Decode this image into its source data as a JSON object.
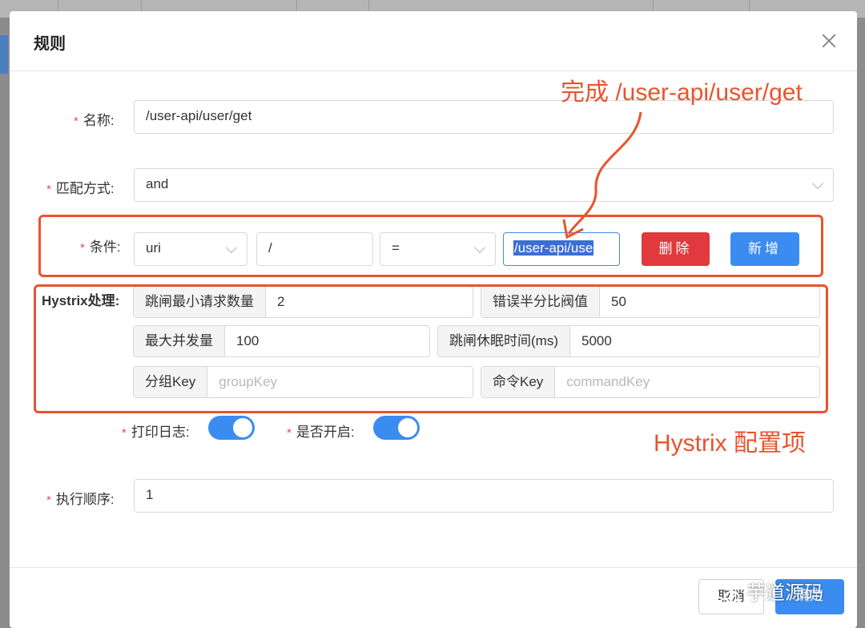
{
  "dialog": {
    "title": "规则"
  },
  "form": {
    "name": {
      "label": "名称:",
      "value": "/user-api/user/get"
    },
    "match_mode": {
      "label": "匹配方式:",
      "value": "and"
    },
    "conditions": {
      "label": "条件:",
      "field": "uri",
      "path_hint": "/",
      "operator": "=",
      "value": "/user-api/use",
      "delete_label": "删除",
      "add_label": "新增"
    },
    "hystrix": {
      "label": "Hystrix处理:",
      "circuit_min_requests": {
        "label": "跳闸最小请求数量",
        "value": "2"
      },
      "error_threshold": {
        "label": "错误半分比阀值",
        "value": "50"
      },
      "max_concurrency": {
        "label": "最大并发量",
        "value": "100"
      },
      "sleep_time": {
        "label": "跳闸休眠时间(ms)",
        "value": "5000"
      },
      "group_key": {
        "label": "分组Key",
        "placeholder": "groupKey"
      },
      "command_key": {
        "label": "命令Key",
        "placeholder": "commandKey"
      }
    },
    "print_log": {
      "label": "打印日志:",
      "enabled": true
    },
    "enabled": {
      "label": "是否开启:",
      "enabled": true
    },
    "sort": {
      "label": "执行顺序:",
      "value": "1"
    }
  },
  "annotations": {
    "top": "完成 /user-api/user/get",
    "bottom": "Hystrix 配置项",
    "color": "#e8542e"
  },
  "footer": {
    "cancel_label": "取消",
    "ok_label": "确定",
    "watermark": "芋道源码"
  },
  "colors": {
    "primary": "#3b8cf0",
    "danger": "#e03a3e",
    "required": "#e8494b"
  }
}
